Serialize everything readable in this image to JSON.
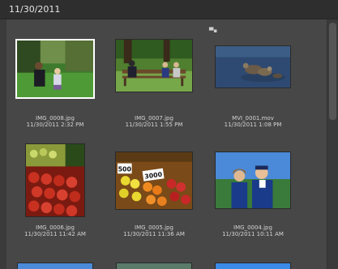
{
  "header": {
    "date_title": "11/30/2011"
  },
  "items": [
    {
      "filename": "IMG_0008.jpg",
      "datetime": "11/30/2011 2:32 PM",
      "icon": "children-on-grass-photo",
      "selected": true
    },
    {
      "filename": "IMG_0007.jpg",
      "datetime": "11/30/2011 1:55 PM",
      "icon": "park-bench-people-photo"
    },
    {
      "filename": "MVI_0001.mov",
      "datetime": "11/30/2011 1:08 PM",
      "icon": "ducks-on-water-video"
    },
    {
      "filename": "IMG_0006.jpg",
      "datetime": "11/30/2011 11:42 AM",
      "icon": "tomatoes-market-photo"
    },
    {
      "filename": "IMG_0005.jpg",
      "datetime": "11/30/2011 11:36 AM",
      "icon": "fruit-stall-prices-photo"
    },
    {
      "filename": "IMG_0004.jpg",
      "datetime": "11/30/2011 10:11 AM",
      "icon": "couple-portrait-photo"
    }
  ],
  "photo_texts": {
    "price_left": "500",
    "price_right": "3000"
  }
}
